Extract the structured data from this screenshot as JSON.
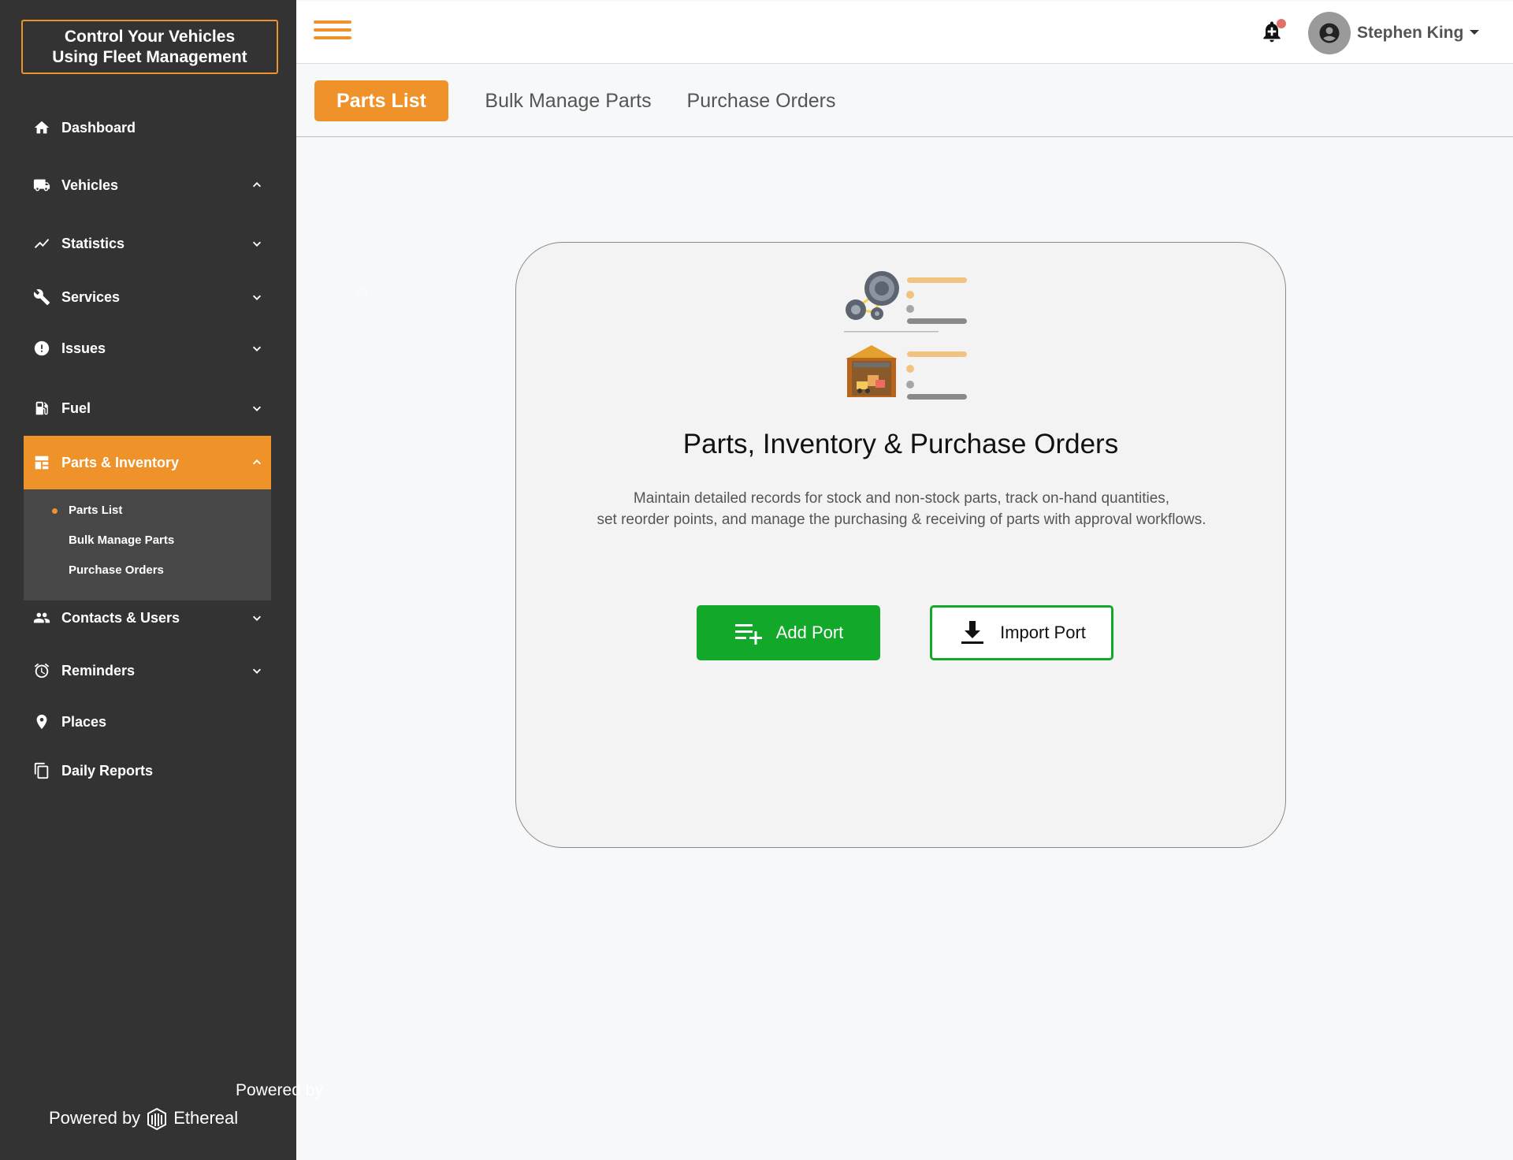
{
  "brand": {
    "line1": "Control Your Vehicles",
    "line2": "Using Fleet Management"
  },
  "sidebar": {
    "items": [
      {
        "label": "Dashboard",
        "icon": "home-icon"
      },
      {
        "label": "Vehicles",
        "icon": "truck-icon",
        "chevron": "up"
      },
      {
        "label": "Statistics",
        "icon": "chart-line-icon",
        "chevron": "down"
      },
      {
        "label": "Services",
        "icon": "wrench-icon",
        "chevron": "down"
      },
      {
        "label": "Issues",
        "icon": "alert-circle-icon",
        "chevron": "down"
      },
      {
        "label": "Fuel",
        "icon": "fuel-pump-icon",
        "chevron": "down"
      },
      {
        "label": "Parts & Inventory",
        "icon": "inventory-icon",
        "chevron": "up",
        "active": true
      },
      {
        "label": "Contacts & Users",
        "icon": "users-icon",
        "chevron": "down"
      },
      {
        "label": "Reminders",
        "icon": "alarm-clock-icon",
        "chevron": "down"
      },
      {
        "label": "Places",
        "icon": "map-pin-icon"
      },
      {
        "label": "Daily Reports",
        "icon": "copy-icon"
      }
    ],
    "submenu": [
      "Parts List",
      "Bulk Manage Parts",
      "Purchase Orders"
    ],
    "active_submenu": "Parts List",
    "ghost_text": "All",
    "powered_by": "Powered by",
    "powered_brand": "Ethereal"
  },
  "topbar": {
    "user_name": "Stephen King",
    "notification_icon": "bell-plus-icon",
    "avatar_icon": "user-circle-icon"
  },
  "tabs": [
    "Parts List",
    "Bulk Manage Parts",
    "Purchase Orders"
  ],
  "active_tab": "Parts List",
  "empty_state": {
    "title": "Parts, Inventory & Purchase Orders",
    "description_line1": "Maintain detailed records for stock and non-stock parts, track on-hand quantities,",
    "description_line2": "set reorder points, and manage the purchasing & receiving of parts with approval workflows.",
    "add_button": "Add Port",
    "import_button": "Import Port"
  },
  "colors": {
    "accent": "#f0922a",
    "sidebar": "#333333",
    "primary_green": "#12a82a"
  }
}
